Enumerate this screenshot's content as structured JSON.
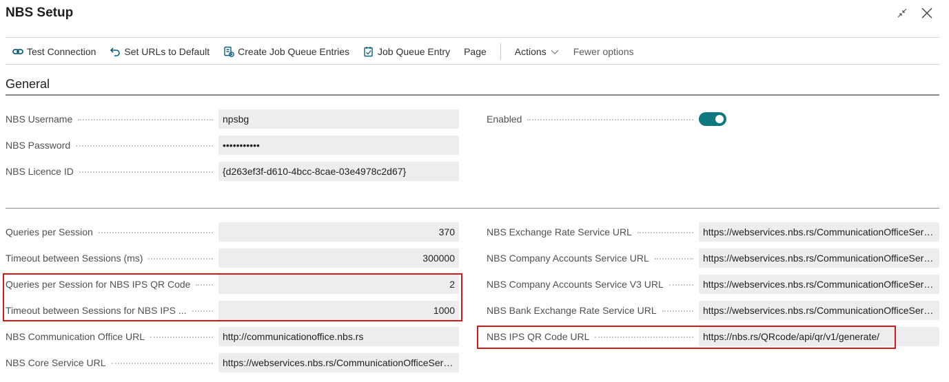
{
  "window": {
    "title": "NBS Setup"
  },
  "toolbar": {
    "items": [
      {
        "label": "Test Connection",
        "icon": "link-icon"
      },
      {
        "label": "Set URLs to Default",
        "icon": "undo-icon"
      },
      {
        "label": "Create Job Queue Entries",
        "icon": "create-entries-icon"
      },
      {
        "label": "Job Queue Entry",
        "icon": "job-queue-icon"
      },
      {
        "label": "Page"
      }
    ],
    "actions_label": "Actions",
    "fewer_options_label": "Fewer options"
  },
  "general": {
    "title": "General",
    "username_label": "NBS Username",
    "username_value": "npsbg",
    "password_label": "NBS Password",
    "password_value": "•••••••••••",
    "licence_label": "NBS Licence ID",
    "licence_value": "{d263ef3f-d610-4bcc-8cae-03e4978c2d67}",
    "enabled_label": "Enabled",
    "enabled": true
  },
  "settings": {
    "left": [
      {
        "label": "Queries per Session",
        "value": "370",
        "numeric": true
      },
      {
        "label": "Timeout between Sessions (ms)",
        "value": "300000",
        "numeric": true
      },
      {
        "label": "Queries per Session for NBS IPS QR Code",
        "value": "2",
        "numeric": true
      },
      {
        "label": "Timeout between Sessions for NBS IPS ...",
        "value": "1000",
        "numeric": true
      },
      {
        "label": "NBS Communication Office URL",
        "value": "http://communicationoffice.nbs.rs",
        "numeric": false
      },
      {
        "label": "NBS Core Service URL",
        "value": "https://webservices.nbs.rs/CommunicationOfficeServi...",
        "numeric": false
      }
    ],
    "right": [
      {
        "label": "NBS Exchange Rate Service URL",
        "value": "https://webservices.nbs.rs/CommunicationOfficeServi..."
      },
      {
        "label": "NBS Company Accounts Service URL",
        "value": "https://webservices.nbs.rs/CommunicationOfficeServi..."
      },
      {
        "label": "NBS Company Accounts Service V3 URL",
        "value": "https://webservices.nbs.rs/CommunicationOfficeServi..."
      },
      {
        "label": "NBS Bank Exchange Rate Service URL",
        "value": "https://webservices.nbs.rs/CommunicationOfficeServi..."
      },
      {
        "label": "NBS IPS QR Code URL",
        "value": "https://nbs.rs/QRcode/api/qr/v1/generate/"
      }
    ]
  },
  "colors": {
    "accent": "#0e7a80",
    "highlight": "#d11a1a",
    "field_bg": "#ededed"
  }
}
